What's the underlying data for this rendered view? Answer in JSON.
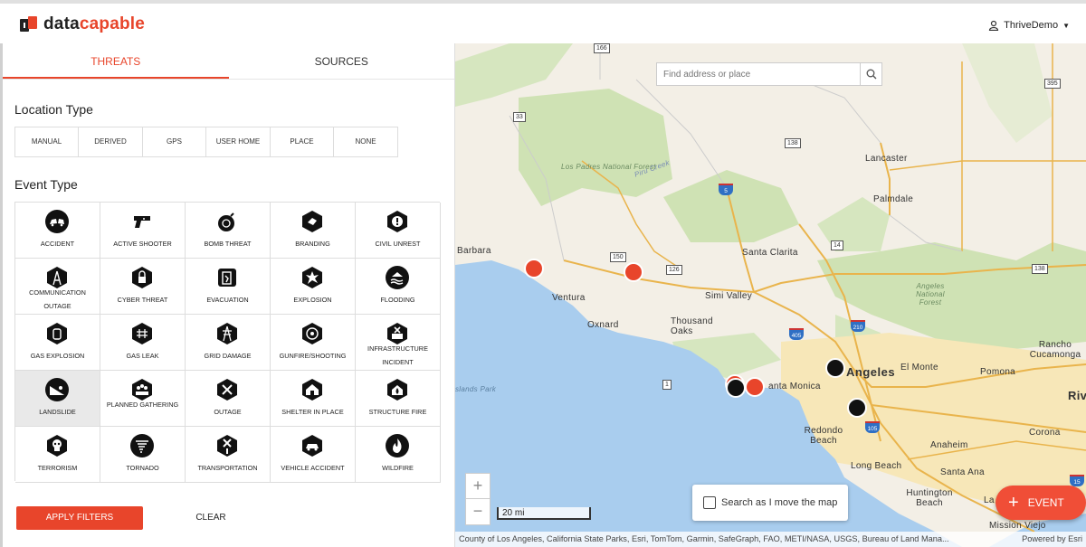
{
  "header": {
    "logo_part1": "data",
    "logo_part2": "capable",
    "user_name": "ThriveDemo",
    "user_icon": "user-icon",
    "caret_icon": "caret-down-icon"
  },
  "tabs": [
    {
      "label": "THREATS",
      "active": true
    },
    {
      "label": "SOURCES",
      "active": false
    }
  ],
  "location_type": {
    "title": "Location Type",
    "options": [
      "MANUAL",
      "DERIVED",
      "GPS",
      "USER HOME",
      "PLACE",
      "NONE"
    ]
  },
  "event_type": {
    "title": "Event Type",
    "items": [
      {
        "label": "ACCIDENT",
        "icon": "car-crash-icon"
      },
      {
        "label": "ACTIVE SHOOTER",
        "icon": "gun-icon"
      },
      {
        "label": "BOMB THREAT",
        "icon": "bomb-icon"
      },
      {
        "label": "BRANDING",
        "icon": "branding-icon"
      },
      {
        "label": "CIVIL UNREST",
        "icon": "alert-icon"
      },
      {
        "label": "COMMUNICATION OUTAGE",
        "icon": "tower-icon"
      },
      {
        "label": "CYBER THREAT",
        "icon": "cyber-lock-icon"
      },
      {
        "label": "EVACUATION",
        "icon": "exit-door-icon"
      },
      {
        "label": "EXPLOSION",
        "icon": "explosion-icon"
      },
      {
        "label": "FLOODING",
        "icon": "flood-icon"
      },
      {
        "label": "GAS EXPLOSION",
        "icon": "gas-explosion-icon"
      },
      {
        "label": "GAS LEAK",
        "icon": "gas-leak-icon"
      },
      {
        "label": "GRID DAMAGE",
        "icon": "power-pylon-icon"
      },
      {
        "label": "GUNFIRE/SHOOTING",
        "icon": "target-icon"
      },
      {
        "label": "INFRASTRUCTURE INCIDENT",
        "icon": "infrastructure-icon"
      },
      {
        "label": "LANDSLIDE",
        "icon": "landslide-icon",
        "selected": true
      },
      {
        "label": "PLANNED GATHERING",
        "icon": "crowd-icon"
      },
      {
        "label": "OUTAGE",
        "icon": "plug-outage-icon"
      },
      {
        "label": "SHELTER IN PLACE",
        "icon": "shelter-icon"
      },
      {
        "label": "STRUCTURE FIRE",
        "icon": "house-fire-icon"
      },
      {
        "label": "TERRORISM",
        "icon": "skull-icon"
      },
      {
        "label": "TORNADO",
        "icon": "tornado-icon"
      },
      {
        "label": "TRANSPORTATION",
        "icon": "road-block-icon"
      },
      {
        "label": "VEHICLE ACCIDENT",
        "icon": "vehicle-accident-icon"
      },
      {
        "label": "WILDFIRE",
        "icon": "fire-icon"
      }
    ]
  },
  "actions": {
    "apply": "APPLY FILTERS",
    "clear": "CLEAR"
  },
  "map": {
    "search_placeholder": "Find address or place",
    "zoom_in": "+",
    "zoom_out": "−",
    "scale": "20 mi",
    "search_move": "Search as I move the map",
    "event_button": "EVENT",
    "attribution": "County of Los Angeles, California State Parks, Esri, TomTom, Garmin, SafeGraph, FAO, METI/NASA, USGS, Bureau of Land Mana...",
    "powered": "Powered by Esri",
    "place_labels": {
      "lancaster": "Lancaster",
      "palmdale": "Palmdale",
      "santa_clarita": "Santa Clarita",
      "simi_valley": "Simi Valley",
      "ventura": "Ventura",
      "oxnard": "Oxnard",
      "thousand_oaks": "Thousand Oaks",
      "barbara": "Barbara",
      "los_angeles": "Angeles",
      "el_monte": "El Monte",
      "pomona": "Pomona",
      "rancho": "Rancho Cucamonga",
      "santa_monica": "anta Monica",
      "redondo": "Redondo Beach",
      "long_beach": "Long Beach",
      "anaheim": "Anaheim",
      "santa_ana": "Santa Ana",
      "huntington": "Huntington Beach",
      "corona": "Corona",
      "riv": "Riv",
      "mission_viejo": "Mission Viejo",
      "la": "La",
      "los_padres": "Los Padres National Forest",
      "piru_creek": "Piru Creek",
      "angeles_nf": "Angeles National Forest",
      "islands": "slands Park"
    },
    "route_shields": [
      "166",
      "33",
      "138",
      "150",
      "126",
      "14",
      "138",
      "395",
      "1"
    ],
    "interstate_shields": [
      "5",
      "210",
      "405",
      "105",
      "15"
    ]
  }
}
